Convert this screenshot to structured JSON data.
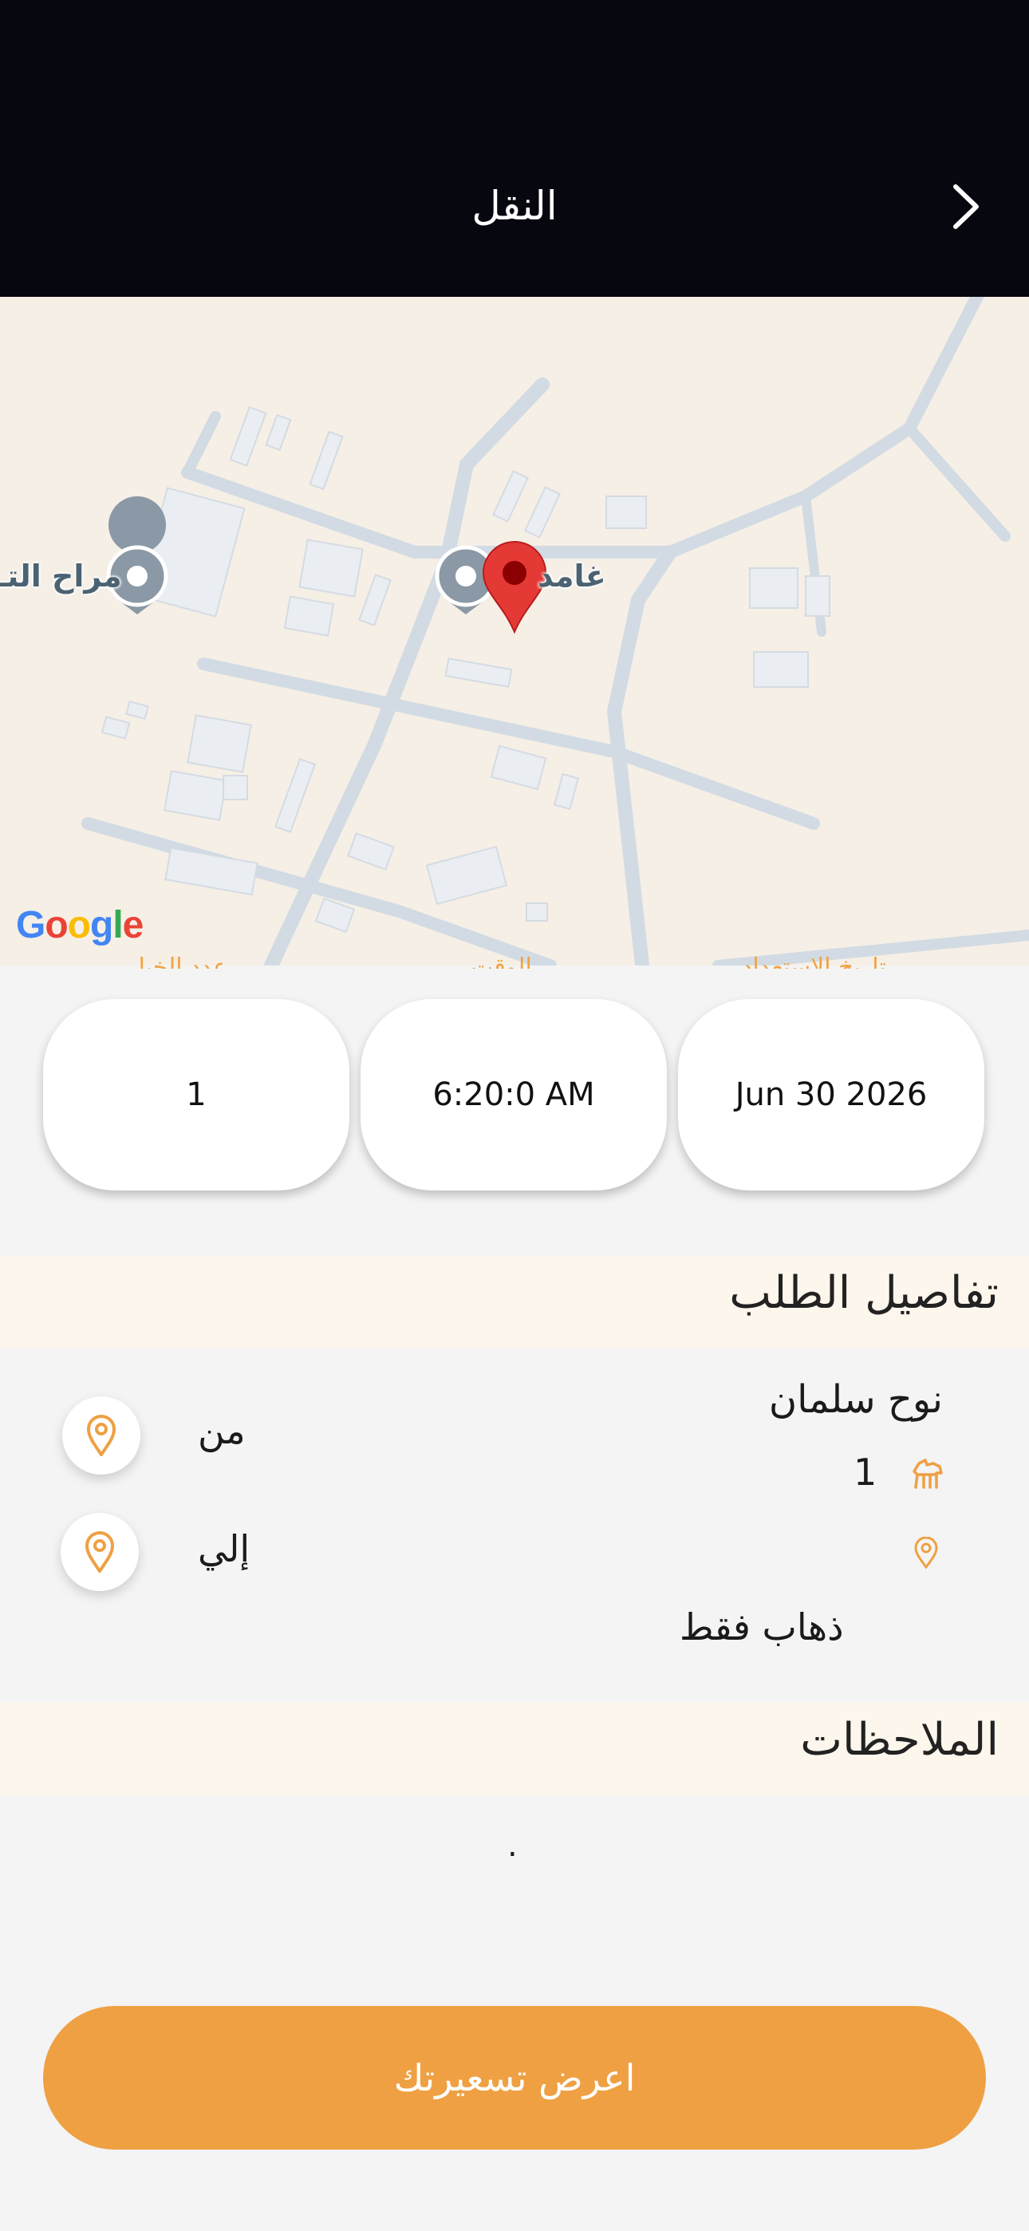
{
  "header": {
    "title": "النقل",
    "back_icon": "chevron-right-icon"
  },
  "map": {
    "label_left": "مراح التـ",
    "label_right": "غامد",
    "google_logo": "Google"
  },
  "info_cards": {
    "labels": [
      "عدد الخيل",
      "الوقت",
      "تاريخ الاستعداد"
    ],
    "count": "1",
    "time": "6:20:0 AM",
    "date": "Jun 30 2026"
  },
  "order_details": {
    "heading": "تفاصيل الطلب",
    "name": "نوح سلمان",
    "horse_count": "1",
    "from_label": "من",
    "to_label": "إلي",
    "trip_type": "ذهاب فقط"
  },
  "notes": {
    "heading": "الملاحظات",
    "text": "."
  },
  "cta": {
    "label": "اعرض تسعيرتك"
  },
  "colors": {
    "accent": "#efa043",
    "header_bg": "#07070f",
    "pin": "#e53935"
  }
}
